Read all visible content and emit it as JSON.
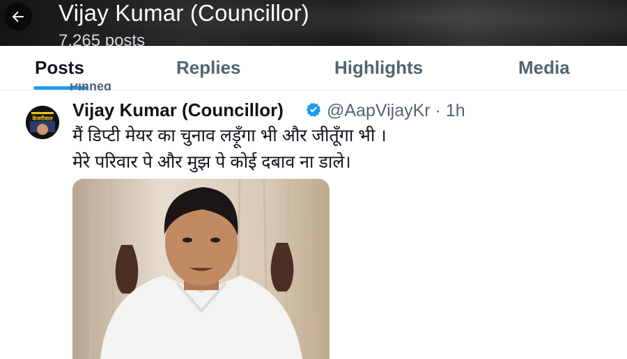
{
  "header": {
    "back_label": "Back",
    "title": "Vijay Kumar (Councillor)",
    "subtitle": "7,265 posts"
  },
  "tabs": [
    {
      "label": "Posts",
      "active": true
    },
    {
      "label": "Replies",
      "active": false
    },
    {
      "label": "Highlights",
      "active": false
    },
    {
      "label": "Media",
      "active": false
    }
  ],
  "pinned_label": "Pinned",
  "tweet": {
    "author_name": "Vijay Kumar (Councillor)",
    "handle_time": "@AapVijayKr · 1h",
    "verified": true,
    "avatar_text": "केजरीवाल",
    "text_lines": [
      "मैं डिप्टी मेयर का चुनाव लड़ूँगा भी और जीतूँगा भी ।",
      "मेरे परिवार पे और मुझ पे कोई दबाव ना डाले।"
    ]
  },
  "colors": {
    "accent": "#1d9bf0",
    "text_primary": "#0f1419",
    "text_secondary": "#536471"
  }
}
